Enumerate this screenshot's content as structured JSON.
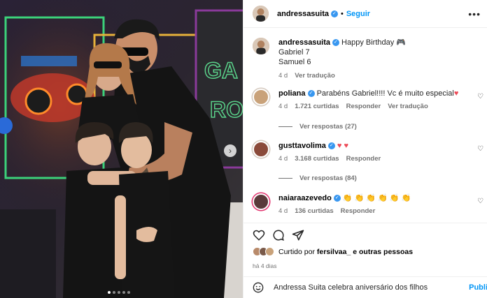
{
  "colors": {
    "accent": "#0095f6",
    "verified": "#3897f0",
    "heart": "#ed4956",
    "muted": "#737373"
  },
  "photo": {
    "next_icon": "chevron-right-icon",
    "dots_count": 5,
    "active_dot": 0
  },
  "header": {
    "username": "andressasuita",
    "separator": "•",
    "follow_label": "Seguir",
    "more_icon": "more-horizontal-icon"
  },
  "caption": {
    "username": "andressasuita",
    "line1": "Happy Birthday 🎮",
    "line2": "Gabriel 7",
    "line3": "Samuel 6",
    "time": "4 d",
    "translate": "Ver tradução"
  },
  "comments": [
    {
      "username": "poliana",
      "text": "Parabéns Gabriel!!!! Vc é muito especial",
      "heart": "♥",
      "time": "4 d",
      "likes": "1.721 curtidas",
      "reply": "Responder",
      "translate": "Ver tradução",
      "view_replies": "Ver respostas (27)"
    },
    {
      "username": "gusttavolima",
      "text": "♥ ♥",
      "time": "4 d",
      "likes": "3.168 curtidas",
      "reply": "Responder",
      "view_replies": "Ver respostas (84)"
    },
    {
      "username": "naiaraazevedo",
      "text": "👏 👏 👏 👏 👏 👏",
      "time": "4 d",
      "likes": "136 curtidas",
      "reply": "Responder"
    }
  ],
  "likes": {
    "prefix": "Curtido por",
    "user": "fersilvaa_",
    "suffix": "e outras pessoas"
  },
  "date": "há 4 dias",
  "add_comment": {
    "text": "Andressa Suita celebra aniversário dos filhos",
    "publish": "Publi"
  }
}
